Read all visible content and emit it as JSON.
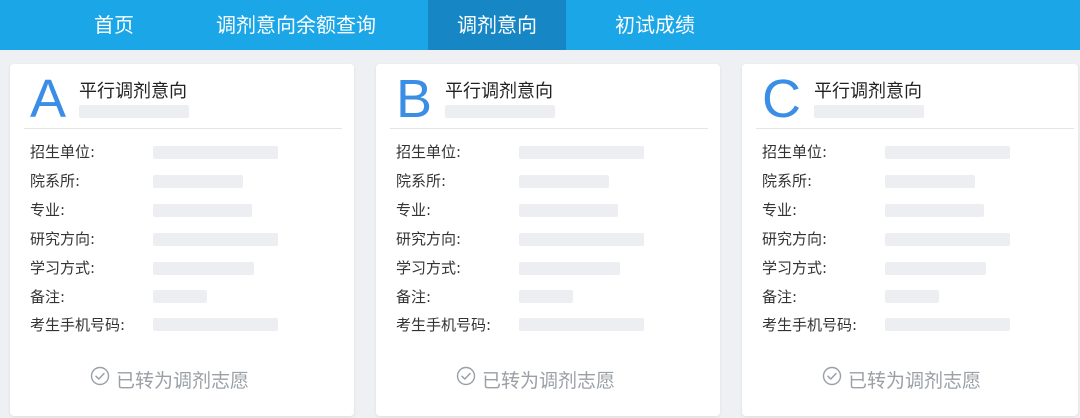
{
  "nav": {
    "items": [
      {
        "label": "首页"
      },
      {
        "label": "调剂意向余额查询"
      },
      {
        "label": "调剂意向",
        "active": true
      },
      {
        "label": "初试成绩"
      }
    ],
    "active_color": "#1687c4",
    "bar_color": "#1aa6e7"
  },
  "cards": [
    {
      "letter": "A",
      "title": "平行调剂意向",
      "fields": [
        {
          "label": "招生单位:"
        },
        {
          "label": "院系所:"
        },
        {
          "label": "专业:"
        },
        {
          "label": "研究方向:"
        },
        {
          "label": "学习方式:"
        },
        {
          "label": "备注:"
        },
        {
          "label": "考生手机号码:"
        }
      ],
      "status": "已转为调剂志愿"
    },
    {
      "letter": "B",
      "title": "平行调剂意向",
      "fields": [
        {
          "label": "招生单位:"
        },
        {
          "label": "院系所:"
        },
        {
          "label": "专业:"
        },
        {
          "label": "研究方向:"
        },
        {
          "label": "学习方式:"
        },
        {
          "label": "备注:"
        },
        {
          "label": "考生手机号码:"
        }
      ],
      "status": "已转为调剂志愿"
    },
    {
      "letter": "C",
      "title": "平行调剂意向",
      "fields": [
        {
          "label": "招生单位:"
        },
        {
          "label": "院系所:"
        },
        {
          "label": "专业:"
        },
        {
          "label": "研究方向:"
        },
        {
          "label": "学习方式:"
        },
        {
          "label": "备注:"
        },
        {
          "label": "考生手机号码:"
        }
      ],
      "status": "已转为调剂志愿"
    }
  ],
  "accent_color": "#3a8ee6",
  "status_icon": "check-circle-icon"
}
